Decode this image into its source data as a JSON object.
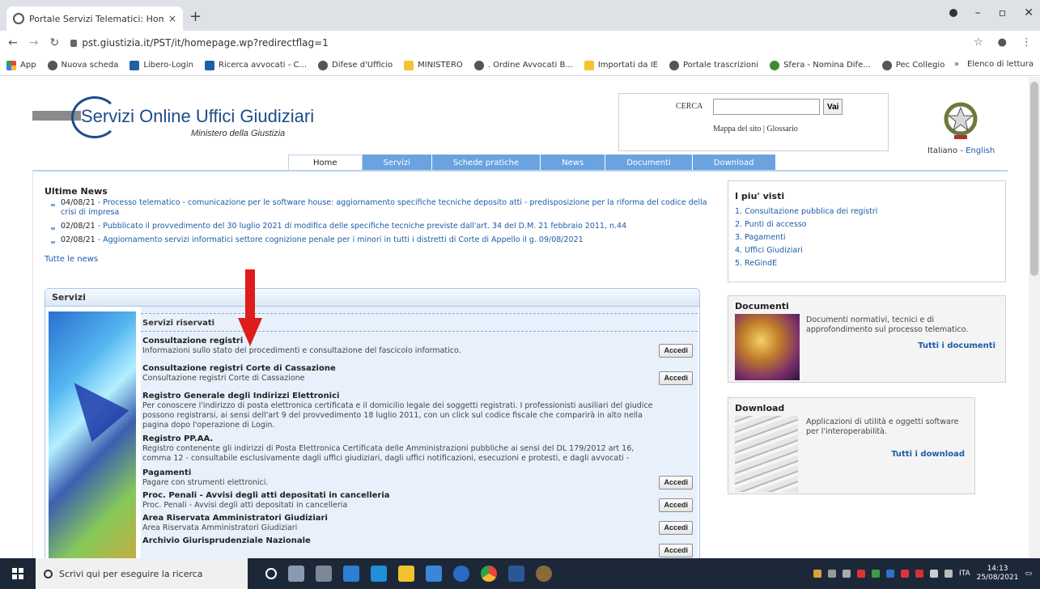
{
  "browser": {
    "tab_title": "Portale Servizi Telematici: Home",
    "tab_close": "×",
    "new_tab": "+",
    "url": "pst.giustizia.it/PST/it/homepage.wp?redirectflag=1",
    "bookmarks": [
      {
        "label": "App",
        "icon": "apps-icon"
      },
      {
        "label": "Nuova scheda",
        "icon": "globe-icon"
      },
      {
        "label": "Libero-Login",
        "icon": "libero-icon"
      },
      {
        "label": "Ricerca avvocati - C...",
        "icon": "site-icon"
      },
      {
        "label": "Difese d'Ufficio",
        "icon": "globe-icon"
      },
      {
        "label": "MINISTERO",
        "icon": "folder-icon"
      },
      {
        "label": ". Ordine Avvocati B...",
        "icon": "globe-icon"
      },
      {
        "label": "Importati da IE",
        "icon": "folder-icon"
      },
      {
        "label": "Portale trascrizioni",
        "icon": "google-icon"
      },
      {
        "label": "Sfera - Nomina Dife...",
        "icon": "sfera-icon"
      },
      {
        "label": "Pec Collegio",
        "icon": "globe-icon"
      }
    ],
    "bookmarks_more": "»",
    "reading_list": "Elenco di lettura"
  },
  "site": {
    "logo_title": "Servizi Online Uffici Giudiziari",
    "logo_subtitle": "Ministero della Giustizia",
    "search_label": "CERCA",
    "search_value": "",
    "search_button": "Vai",
    "search_links": "Mappa del sito | Glossario",
    "lang_it": "Italiano",
    "lang_sep": " - ",
    "lang_en": "English",
    "nav_tabs": [
      "Home",
      "Servizi",
      "Schede pratiche",
      "News",
      "Documenti",
      "Download"
    ]
  },
  "news": {
    "title": "Ultime News",
    "items": [
      {
        "date": "04/08/21",
        "text": " - Processo telematico - comunicazione per le software house: aggiornamento specifiche tecniche deposito atti - predisposizione per la riforma del codice della crisi di impresa"
      },
      {
        "date": "02/08/21",
        "text": " - Pubblicato il provvedimento del 30 luglio 2021 di modifica delle specifiche tecniche previste dall'art. 34 del D.M. 21 febbraio 2011, n.44"
      },
      {
        "date": "02/08/21",
        "text": " - Aggiornamento servizi informatici settore cognizione penale per i minori in tutti i distretti di Corte di Appello il g. 09/08/2021"
      }
    ],
    "all_link": "Tutte le news"
  },
  "servizi": {
    "title": "Servizi",
    "subtitle": "Servizi riservati",
    "accedi": "Accedi",
    "items": [
      {
        "name": "Consultazione registri",
        "desc": "Informazioni sullo stato del procedimenti e consultazione del fascicolo informatico."
      },
      {
        "name": "Consultazione registri Corte di Cassazione",
        "desc": "Consultazione registri Corte di Cassazione"
      },
      {
        "name": "Registro Generale degli Indirizzi Elettronici",
        "desc": "Per conoscere l'indirizzo di posta elettronica certificata e il domicilio legale dei soggetti registrati. I professionisti ausiliari del giudice possono registrarsi, ai sensi dell'art 9 del provvedimento 18 luglio 2011, con un click sul codice fiscale che comparirà in alto nella pagina dopo l'operazione di Login."
      },
      {
        "name": "Registro PP.AA.",
        "desc": "Registro contenente gli indirizzi di Posta Elettronica Certificata delle Amministrazioni pubbliche ai sensi del DL 179/2012 art 16, comma 12 - consultabile esclusivamente dagli uffici giudiziari, dagli uffici notificazioni, esecuzioni e protesti, e dagli avvocati -"
      },
      {
        "name": "Pagamenti",
        "desc": "Pagare con strumenti elettronici."
      },
      {
        "name": "Proc. Penali - Avvisi degli atti depositati in cancelleria",
        "desc": "Proc. Penali - Avvisi degli atti depositati in cancelleria"
      },
      {
        "name": "Area Riservata Amministratori Giudiziari",
        "desc": "Area Riservata Amministratori Giudiziari"
      },
      {
        "name": "Archivio Giurisprudenziale Nazionale",
        "desc": ""
      }
    ]
  },
  "piu_visti": {
    "title": "I piu' visti",
    "items": [
      "1. Consultazione pubblica dei registri",
      "2. Punti di accesso",
      "3. Pagamenti",
      "4. Uffici Giudiziari",
      "5. ReGindE"
    ]
  },
  "documenti": {
    "title": "Documenti",
    "desc": "Documenti normativi, tecnici e di approfondimento sul processo telematico.",
    "link": "Tutti i documenti"
  },
  "download": {
    "title": "Download",
    "desc": "Applicazioni di utilità e oggetti software per l'interoperabilità.",
    "link": "Tutti i download"
  },
  "taskbar": {
    "search_placeholder": "Scrivi qui per eseguire la ricerca",
    "lang": "ITA",
    "time": "14:13",
    "date": "25/08/2021"
  },
  "colors": {
    "nav_tab": "#6aa3df",
    "link": "#1d5ba8",
    "arrow": "#e01b1b",
    "taskbar": "#1c2838"
  }
}
